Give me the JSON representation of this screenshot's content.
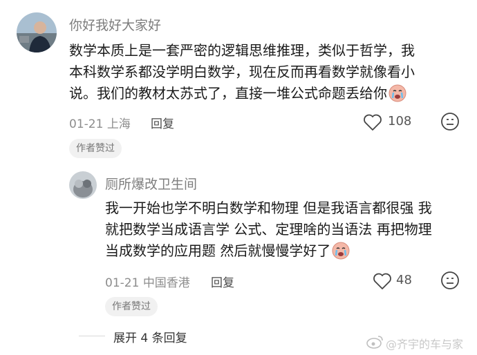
{
  "comments": [
    {
      "username": "你好我好大家好",
      "lines": [
        "数学本质上是一套严密的逻辑思维推理，类似于哲学，我",
        "本科数学系都没学明白数学，现在反而再看数学就像看小",
        "说。我们的教材太苏式了，直接一堆公式命题丢给你"
      ],
      "date": "01-21",
      "location": "上海",
      "reply_label": "回复",
      "likes": "108",
      "badge": "作者赞过",
      "emoji": "crying-face"
    },
    {
      "username": "厕所爆改卫生间",
      "lines": [
        "我一开始也学不明白数学和物理 但是我语言都很强 我",
        "就把数学当成语言学 公式、定理啥的当语法 再把物理",
        "当成数学的应用题 然后就慢慢学好了"
      ],
      "date": "01-21",
      "location": "中国香港",
      "reply_label": "回复",
      "likes": "48",
      "badge": "作者赞过",
      "emoji": "crying-face"
    }
  ],
  "expand_label": "展开 4 条回复",
  "watermark": "@齐宇的车与家",
  "colors": {
    "username": "#7d7d7d",
    "text": "#1a1a1a",
    "meta": "#8c8c8c",
    "badge_bg": "#f1f1f1"
  }
}
